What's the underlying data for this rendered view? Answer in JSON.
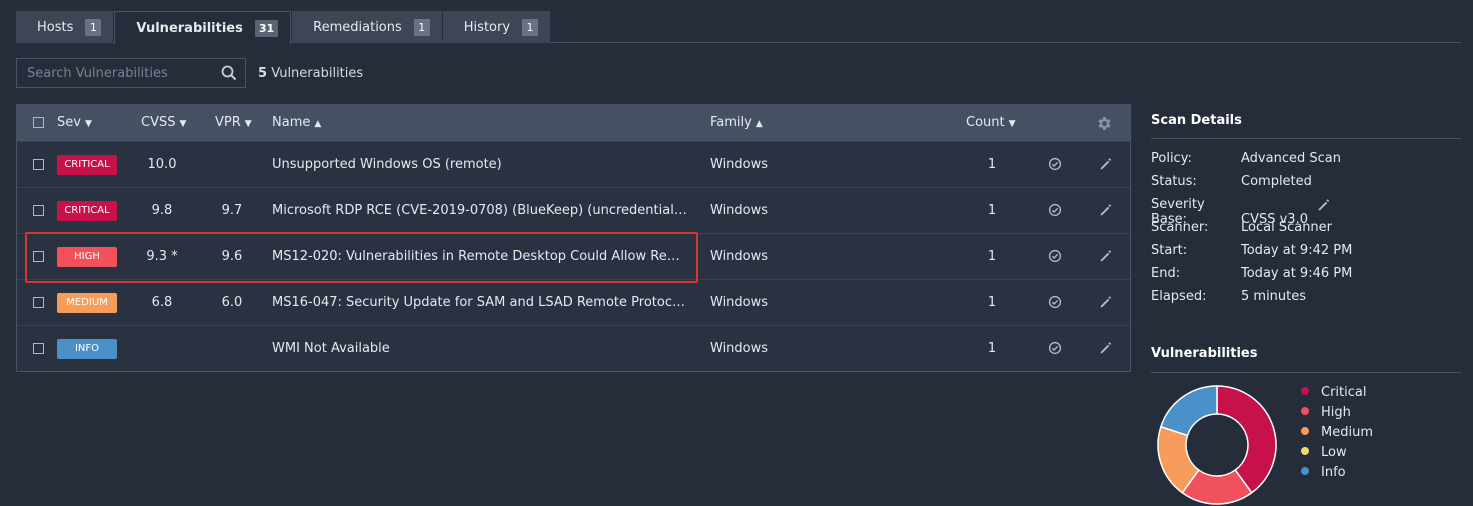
{
  "tabs": [
    {
      "label": "Hosts",
      "count": "1"
    },
    {
      "label": "Vulnerabilities",
      "count": "31"
    },
    {
      "label": "Remediations",
      "count": "1"
    },
    {
      "label": "History",
      "count": "1"
    }
  ],
  "search": {
    "placeholder": "Search Vulnerabilities",
    "value": ""
  },
  "result_count": {
    "number": "5",
    "label": "Vulnerabilities"
  },
  "table": {
    "headers": {
      "sev": "Sev",
      "cvss": "CVSS",
      "vpr": "VPR",
      "name": "Name",
      "family": "Family",
      "count": "Count"
    },
    "rows": [
      {
        "sev": "CRITICAL",
        "sev_color": "#c7114a",
        "cvss": "10.0",
        "vpr": "",
        "name": "Unsupported Windows OS (remote)",
        "family": "Windows",
        "count": "1"
      },
      {
        "sev": "CRITICAL",
        "sev_color": "#c7114a",
        "cvss": "9.8",
        "vpr": "9.7",
        "name": "Microsoft RDP RCE (CVE-2019-0708) (BlueKeep) (uncredentialed che...",
        "family": "Windows",
        "count": "1"
      },
      {
        "sev": "HIGH",
        "sev_color": "#f0515a",
        "cvss": "9.3 *",
        "vpr": "9.6",
        "name": "MS12-020: Vulnerabilities in Remote Desktop Could Allow Remote ...",
        "family": "Windows",
        "count": "1"
      },
      {
        "sev": "MEDIUM",
        "sev_color": "#f89c5b",
        "cvss": "6.8",
        "vpr": "6.0",
        "name": "MS16-047: Security Update for SAM and LSAD Remote Protocols (3...",
        "family": "Windows",
        "count": "1"
      },
      {
        "sev": "INFO",
        "sev_color": "#4a90c9",
        "cvss": "",
        "vpr": "",
        "name": "WMI Not Available",
        "family": "Windows",
        "count": "1"
      }
    ]
  },
  "scan_details": {
    "title": "Scan Details",
    "items": [
      {
        "key": "Policy:",
        "value": "Advanced Scan"
      },
      {
        "key": "Status:",
        "value": "Completed"
      },
      {
        "key": "Severity Base:",
        "value": "CVSS v3.0"
      },
      {
        "key": "Scanner:",
        "value": "Local Scanner"
      },
      {
        "key": "Start:",
        "value": "Today at 9:42 PM"
      },
      {
        "key": "End:",
        "value": "Today at 9:46 PM"
      },
      {
        "key": "Elapsed:",
        "value": "5 minutes"
      }
    ]
  },
  "vuln_chart": {
    "title": "Vulnerabilities",
    "legend": [
      {
        "label": "Critical",
        "color": "#c7114a"
      },
      {
        "label": "High",
        "color": "#f0515a"
      },
      {
        "label": "Medium",
        "color": "#f89c5b"
      },
      {
        "label": "Low",
        "color": "#f8d66c"
      },
      {
        "label": "Info",
        "color": "#4a90c9"
      }
    ],
    "slice_fractions": [
      {
        "label": "Critical",
        "value": 0.4,
        "color": "#c7114a"
      },
      {
        "label": "High",
        "value": 0.2,
        "color": "#f0515a"
      },
      {
        "label": "Medium",
        "value": 0.2,
        "color": "#f89c5b"
      },
      {
        "label": "Info",
        "value": 0.2,
        "color": "#4a90c9"
      }
    ]
  }
}
